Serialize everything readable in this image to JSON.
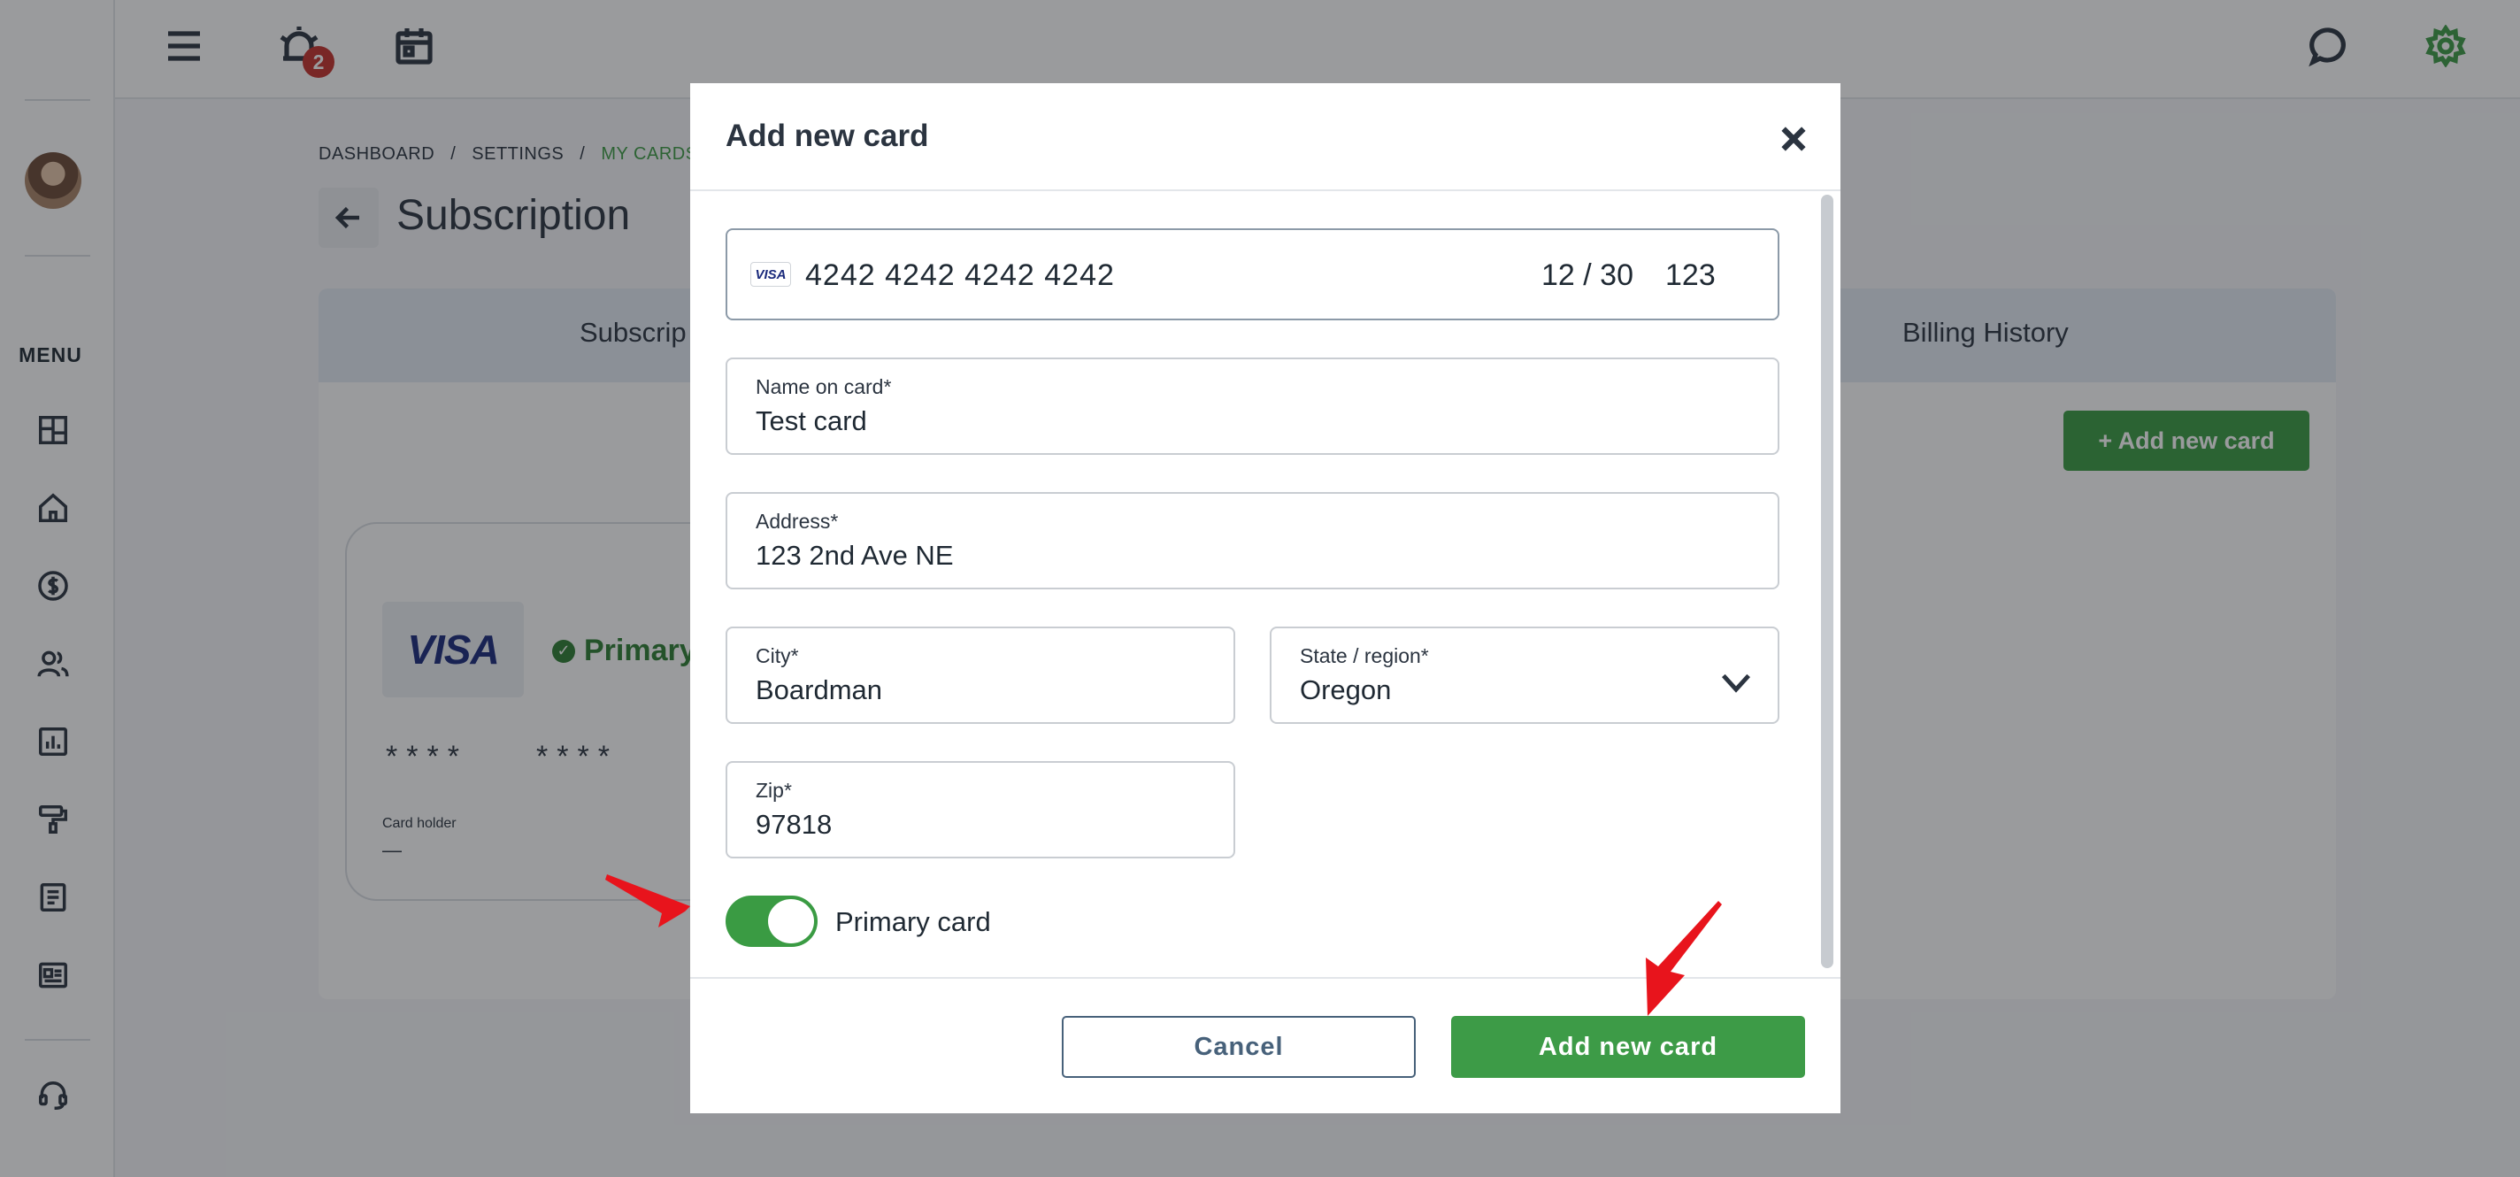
{
  "topbar": {
    "icons": [
      "menu-icon",
      "alarm-icon",
      "calendar-icon",
      "chat-icon",
      "gear-icon"
    ],
    "notification_count": "2"
  },
  "sidebar": {
    "menu_label": "MENU",
    "items": [
      "dashboard-icon",
      "home-icon",
      "dollar-icon",
      "users-icon",
      "chart-icon",
      "paint-roller-icon",
      "document-icon",
      "news-icon",
      "support-icon"
    ]
  },
  "breadcrumb": {
    "items": [
      "DASHBOARD",
      "SETTINGS",
      "MY CARDS"
    ],
    "separator": "/"
  },
  "page": {
    "title": "Subscription"
  },
  "tabs": {
    "subscription": "Subscrip",
    "billing_history": "Billing History"
  },
  "cards_section": {
    "add_button": "+ Add new card",
    "card": {
      "brand": "VISA",
      "status": "Primary",
      "masked_group_1": "****",
      "masked_group_2": "****",
      "holder_label": "Card holder",
      "holder_value": "—"
    }
  },
  "modal": {
    "title": "Add new card",
    "card_number": "4242 4242 4242 4242",
    "card_brand": "VISA",
    "expiry": "12 / 30",
    "cvc": "123",
    "fields": {
      "name": {
        "label": "Name on card*",
        "value": "Test card"
      },
      "address": {
        "label": "Address*",
        "value": "123 2nd Ave NE"
      },
      "city": {
        "label": "City*",
        "value": "Boardman"
      },
      "state": {
        "label": "State / region*",
        "value": "Oregon"
      },
      "zip": {
        "label": "Zip*",
        "value": "97818"
      }
    },
    "primary_toggle": {
      "label": "Primary card",
      "checked": true
    },
    "cancel_label": "Cancel",
    "submit_label": "Add new card"
  },
  "colors": {
    "brand_green": "#3d9b47",
    "overlay": "rgba(25,28,32,0.44)",
    "annotation_arrow": "#e8141c"
  }
}
